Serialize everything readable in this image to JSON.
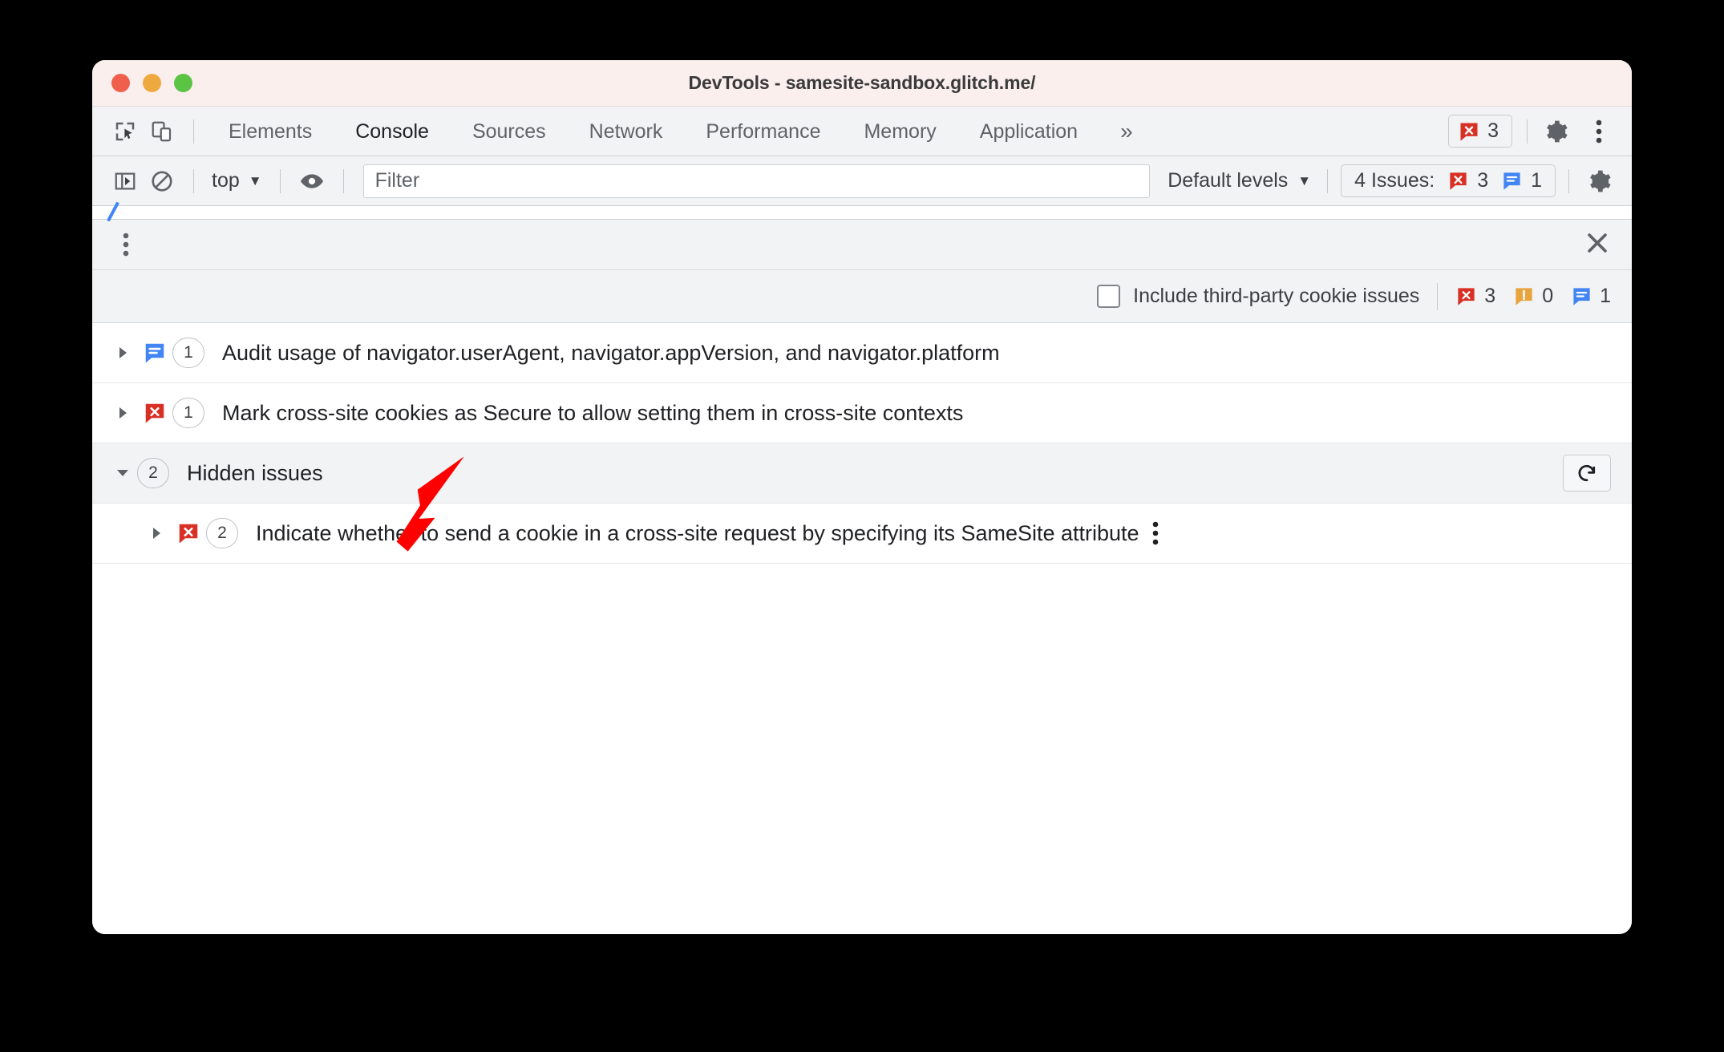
{
  "window": {
    "title": "DevTools - samesite-sandbox.glitch.me/",
    "traffic_lights": [
      "close",
      "minimize",
      "maximize"
    ],
    "colors": {
      "titlebar_bg": "#fbefee",
      "toolbar_bg": "#f1f3f4",
      "error_red": "#d93025",
      "warning_orange": "#e8a33d",
      "info_blue": "#4285f4",
      "annotation_red": "#ff0000"
    }
  },
  "tabbar": {
    "inspect_icon": "inspect-element-icon",
    "device_icon": "device-toolbar-icon",
    "tabs": [
      {
        "label": "Elements",
        "active": false
      },
      {
        "label": "Console",
        "active": true
      },
      {
        "label": "Sources",
        "active": false
      },
      {
        "label": "Network",
        "active": false
      },
      {
        "label": "Performance",
        "active": false
      },
      {
        "label": "Memory",
        "active": false
      },
      {
        "label": "Application",
        "active": false
      }
    ],
    "more_tabs": "»",
    "error_badge": {
      "icon": "error-icon",
      "count": "3"
    },
    "settings_icon": "gear-icon",
    "menu_icon": "kebab-menu-icon"
  },
  "consolebar": {
    "sidebar_toggle_icon": "console-sidebar-icon",
    "clear_icon": "clear-console-icon",
    "context": "top",
    "context_caret": "▼",
    "eye_icon": "live-expression-icon",
    "filter_placeholder": "Filter",
    "filter_value": "",
    "levels_label": "Default levels",
    "levels_caret": "▼",
    "issues_badge": {
      "label": "4 Issues:",
      "error_count": "3",
      "info_count": "1"
    },
    "settings_icon": "gear-icon"
  },
  "drawer": {
    "menu_icon": "kebab-menu-icon",
    "close_icon": "close-icon"
  },
  "options": {
    "checkbox_label": "Include third-party cookie issues",
    "checkbox_checked": false,
    "counts": [
      {
        "kind": "error",
        "value": "3"
      },
      {
        "kind": "warning",
        "value": "0"
      },
      {
        "kind": "info",
        "value": "1"
      }
    ]
  },
  "issues": [
    {
      "expanded": false,
      "kind": "info",
      "count": "1",
      "title": "Audit usage of navigator.userAgent, navigator.appVersion, and navigator.platform"
    },
    {
      "expanded": false,
      "kind": "error",
      "count": "1",
      "title": "Mark cross-site cookies as Secure to allow setting them in cross-site contexts"
    }
  ],
  "hidden_group": {
    "expanded": true,
    "count": "2",
    "title": "Hidden issues",
    "restore_icon": "refresh-icon",
    "children": [
      {
        "expanded": false,
        "kind": "error",
        "count": "2",
        "title": "Indicate whether to send a cookie in a cross-site request by specifying its SameSite attribute",
        "menu_icon": "kebab-menu-icon"
      }
    ]
  }
}
